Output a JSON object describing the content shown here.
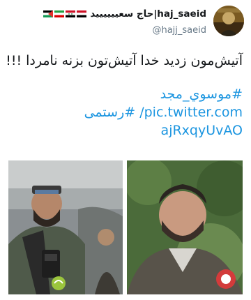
{
  "header": {
    "display_name": "haj_saeid|حاج سعیییییید",
    "handle": "@hajj_saeid",
    "flags": [
      "iraq-flag",
      "syria-flag",
      "iran-flag",
      "palestine-flag"
    ]
  },
  "tweet": {
    "text": "آتیش‌مون زدید خدا آتیش‌تون بزنه نامردا !!!",
    "hashtag_1": "#موسوي_مجد",
    "hashtag_2": "#رستمی",
    "link_line_1": "pic.twitter.com/",
    "link_line_2": "ajRxqyUvAO"
  },
  "media": {
    "photos": [
      "photo-left",
      "photo-right"
    ],
    "colors": {
      "link": "#1b95e0",
      "handle": "#657786",
      "text": "#14171a"
    }
  }
}
